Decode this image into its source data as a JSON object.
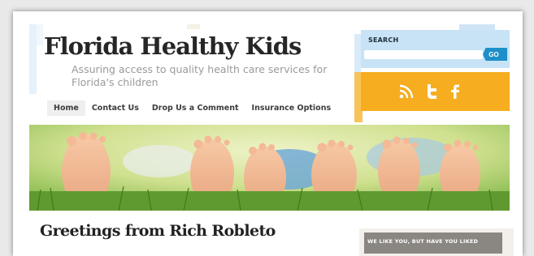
{
  "site": {
    "title": "Florida Healthy Kids",
    "tagline": "Assuring access to quality health care services for Florida's children"
  },
  "nav": {
    "items": [
      {
        "label": "Home",
        "active": true
      },
      {
        "label": "Contact Us"
      },
      {
        "label": "Drop Us a Comment"
      },
      {
        "label": "Insurance Options"
      }
    ]
  },
  "search": {
    "label": "SEARCH",
    "button_label": "GO",
    "value": ""
  },
  "social": {
    "icons": [
      "rss-icon",
      "twitter-icon",
      "facebook-icon"
    ]
  },
  "post": {
    "title": "Greetings from Rich Robleto"
  },
  "widget": {
    "text": "WE LIKE YOU, BUT HAVE YOU LIKED"
  },
  "colors": {
    "search_bg": "#c8e3f6",
    "go_button": "#1e8fc9",
    "social_bg": "#f6ad1f"
  }
}
